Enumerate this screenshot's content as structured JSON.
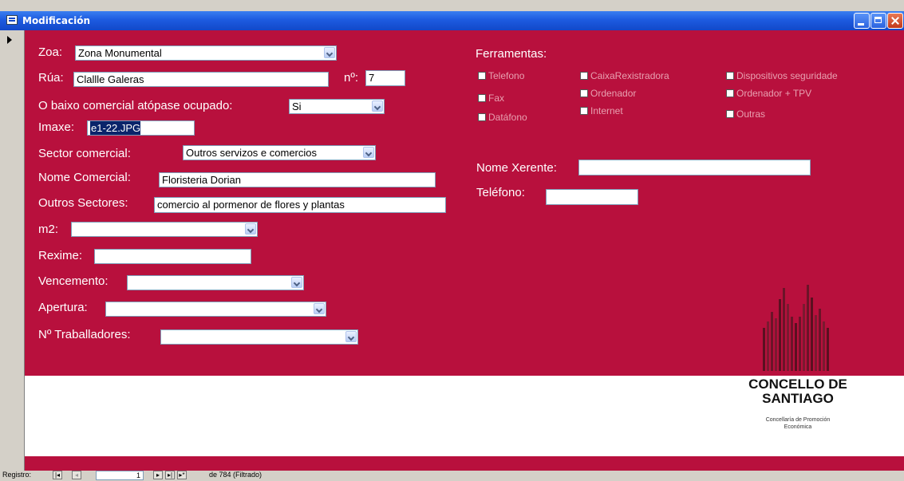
{
  "window": {
    "title": "Modificación"
  },
  "form": {
    "zoa": {
      "label": "Zoa:",
      "value": "Zona Monumental"
    },
    "rua": {
      "label": "Rúa:",
      "value": "Clallle Galeras"
    },
    "numero": {
      "label": "nº:",
      "value": "7"
    },
    "ocupado": {
      "label": "O baixo comercial atópase ocupado:",
      "value": "Si"
    },
    "imaxe": {
      "label": "Imaxe:",
      "value": "e1-22.JPG"
    },
    "sector": {
      "label": "Sector comercial:",
      "value": "Outros servizos e comercios"
    },
    "nome_comercial": {
      "label": "Nome Comercial:",
      "value": "Floristeria Dorian"
    },
    "outros_sectores": {
      "label": "Outros Sectores:",
      "value": "comercio al pormenor de flores y plantas"
    },
    "m2": {
      "label": "m2:",
      "value": ""
    },
    "rexime": {
      "label": "Rexime:",
      "value": ""
    },
    "vencemento": {
      "label": "Vencemento:",
      "value": ""
    },
    "apertura": {
      "label": "Apertura:",
      "value": ""
    },
    "traballadores": {
      "label": "Nº Traballadores:",
      "value": ""
    },
    "ferramentas": {
      "label": "Ferramentas:",
      "items": [
        "Telefono",
        "Fax",
        "Datáfono",
        "CaixaRexistradora",
        "Ordenador",
        "Internet",
        "Dispositivos seguridade",
        "Ordenador + TPV",
        "Outras"
      ]
    },
    "nome_xerente": {
      "label": "Nome Xerente:",
      "value": ""
    },
    "telefono": {
      "label": "Teléfono:",
      "value": ""
    }
  },
  "logo": {
    "line1": "CONCELLO DE",
    "line2": "SANTIAGO",
    "sub1": "Concellaría de Promoción",
    "sub2": "Económica"
  },
  "status": {
    "label": "Registro:",
    "current": "1",
    "total_text": "de 784 (Filtrado)"
  },
  "colors": {
    "form_bg": "#b8103d",
    "titlebar": "#1d5be0"
  }
}
